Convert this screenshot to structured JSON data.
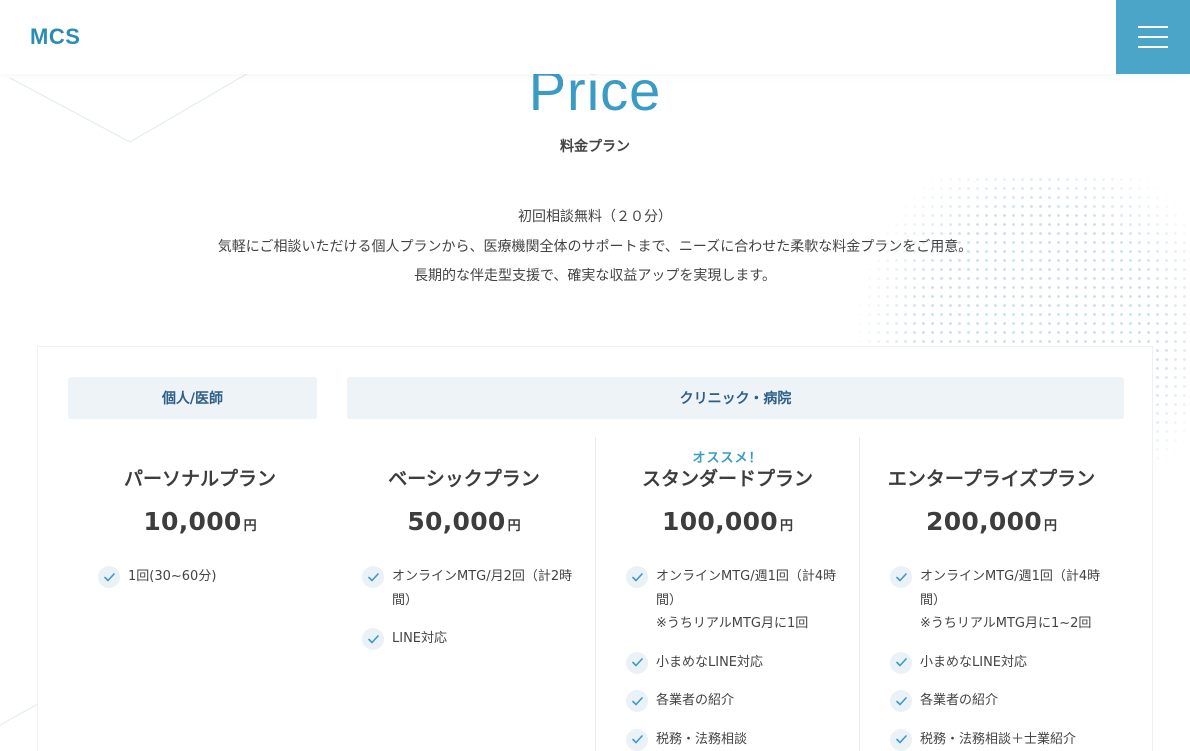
{
  "header": {
    "logo": "MCS",
    "menu_icon": "hamburger-menu-icon"
  },
  "section": {
    "title_en": "Price",
    "title_ja": "料金プラン",
    "intro": [
      "初回相談無料（２０分）",
      "気軽にご相談いただける個人プランから、医療機関全体のサポートまで、ニーズに合わせた柔軟な料金プランをご用意。",
      "長期的な伴走型支援で、確実な収益アップを実現します。"
    ]
  },
  "categories": {
    "personal": "個人/医師",
    "clinic": "クリニック・病院"
  },
  "plans": [
    {
      "name": "パーソナルプラン",
      "price": "10,000",
      "unit": "円",
      "features": [
        "1回(30~60分)"
      ]
    },
    {
      "name": "ベーシックプラン",
      "price": "50,000",
      "unit": "円",
      "features": [
        "オンラインMTG/月2回（計2時間）",
        "LINE対応"
      ]
    },
    {
      "badge": "オススメ！",
      "name": "スタンダードプラン",
      "price": "100,000",
      "unit": "円",
      "features": [
        "オンラインMTG/週1回（計4時間）\n※うちリアルMTG月に1回",
        "小まめなLINE対応",
        "各業者の紹介",
        "税務・法務相談"
      ]
    },
    {
      "name": "エンタープライズプラン",
      "price": "200,000",
      "unit": "円",
      "features": [
        "オンラインMTG/週1回（計4時間）\n※うちリアルMTG月に1~2回",
        "小まめなLINE対応",
        "各業者の紹介",
        "税務・法務相談＋士業紹介"
      ]
    }
  ],
  "colors": {
    "accent": "#3a9cc4",
    "menu_bg": "#4ba5c9",
    "category_bg": "#eef3f8",
    "category_text": "#2e5f86"
  }
}
